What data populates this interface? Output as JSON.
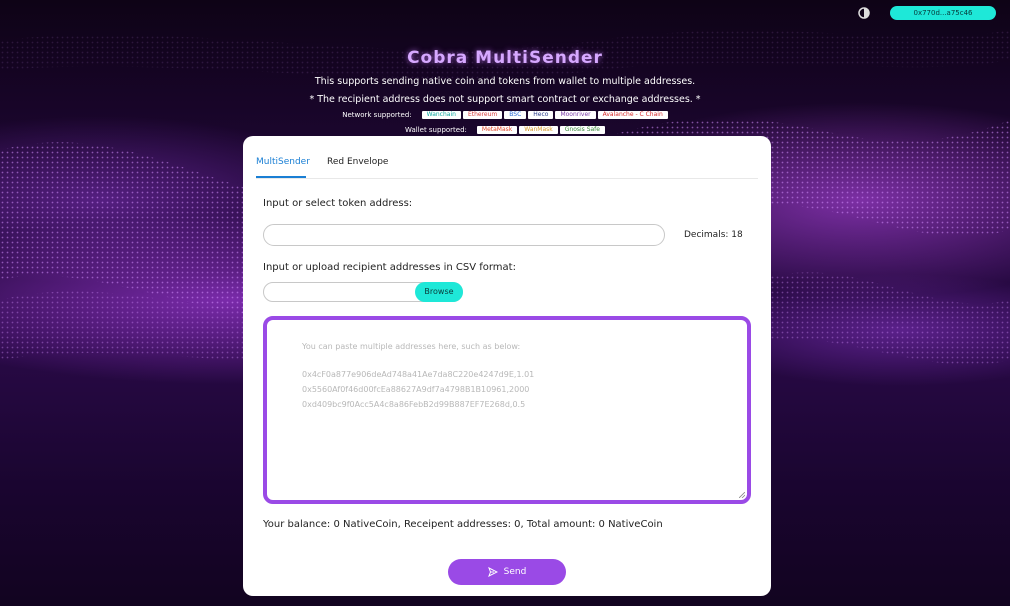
{
  "header": {
    "wallet_address": "0x770d...a75c46",
    "title": "Cobra MultiSender",
    "subtitle": "This supports sending native coin and tokens from wallet to multiple addresses.",
    "notice": "* The recipient address does not support smart contract or exchange addresses. *",
    "network_label": "Network supported:",
    "networks": [
      {
        "name": "Wanchain",
        "color": "#12a8a0"
      },
      {
        "name": "Ethereum",
        "color": "#d84040"
      },
      {
        "name": "BSC",
        "color": "#2a6ad4"
      },
      {
        "name": "Heco",
        "color": "#2a3a8a"
      },
      {
        "name": "Moonriver",
        "color": "#7a3aa8"
      },
      {
        "name": "Avalanche - C Chain",
        "color": "#d82a2a"
      }
    ],
    "wallet_label": "Wallet supported:",
    "wallets": [
      {
        "name": "MetaMask",
        "color": "#e0482a"
      },
      {
        "name": "WanMask",
        "color": "#d89a2a"
      },
      {
        "name": "Gnosis Safe",
        "color": "#3a8a3a"
      }
    ]
  },
  "tabs": [
    {
      "label": "MultiSender",
      "active": true
    },
    {
      "label": "Red Envelope",
      "active": false
    }
  ],
  "form": {
    "token_label": "Input or select token address:",
    "token_value": "",
    "decimals": "Decimals: 18",
    "csv_label": "Input or upload recipient addresses in CSV format:",
    "browse_label": "Browse",
    "placeholder_intro": "You can paste multiple addresses here, such as below:",
    "placeholder_examples": [
      "0x4cF0a877e906deAd748a41Ae7da8C220e4247d9E,1.01",
      "0x5560Af0f46d00fcEa88627A9df7a4798B1B10961,2000",
      "0xd409bc9f0Acc5A4c8a86FebB2d99B887EF7E268d,0.5"
    ],
    "summary": "Your balance: 0 NativeCoin, Receipent addresses: 0, Total amount: 0 NativeCoin",
    "send_label": "Send"
  },
  "colors": {
    "accent": "#9a4ae6",
    "cyan": "#1ee8d8",
    "tab_active": "#1a7fd4"
  }
}
